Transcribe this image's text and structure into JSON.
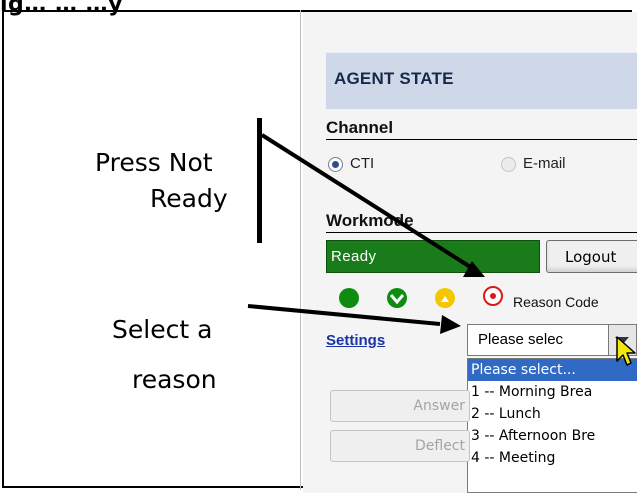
{
  "caption": {
    "text": "ig… … …y"
  },
  "panel": {
    "title": "AGENT STATE",
    "channel": {
      "label": "Channel",
      "options": [
        {
          "label": "CTI",
          "selected": true
        },
        {
          "label": "E-mail",
          "selected": false
        }
      ]
    },
    "workmode": {
      "label": "Workmode",
      "status": "Ready",
      "status_color": "#1a7b1a",
      "logout_label": "Logout"
    },
    "state_icons": [
      "green-dot-icon",
      "green-check-icon",
      "yellow-warning-icon",
      "red-stop-icon"
    ],
    "reason_code_label": "Reason Code",
    "settings_label": "Settings",
    "reason_select": {
      "value": "Please selec",
      "options": [
        "Please select...",
        "1 -- Morning Brea",
        "2 -- Lunch",
        "3 -- Afternoon Bre",
        "4 -- Meeting"
      ]
    },
    "buttons": {
      "answer_label": "Answer",
      "deflect_label": "Deflect"
    }
  },
  "annotations": {
    "not_ready": {
      "line1": "Press Not",
      "line2": "Ready"
    },
    "select_reason": {
      "line1": "Select a",
      "line2": "reason"
    }
  }
}
